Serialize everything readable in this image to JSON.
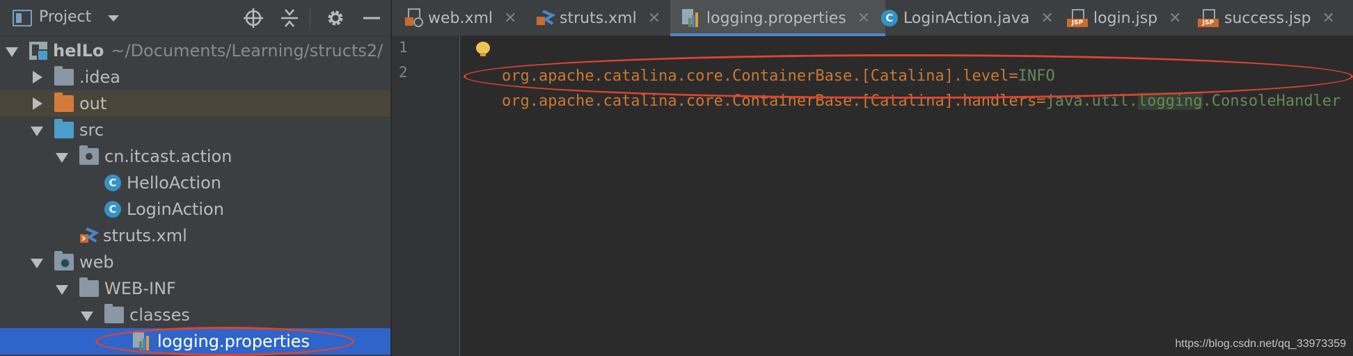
{
  "project_panel": {
    "title": "Project",
    "tree": [
      {
        "label": "helLo",
        "hint": "~/Documents/Learning/structs2/",
        "expanded": true,
        "icon": "module-icon"
      },
      {
        "label": ".idea",
        "expanded": false,
        "icon": "folder-icon"
      },
      {
        "label": "out",
        "expanded": false,
        "icon": "folder-orange-icon"
      },
      {
        "label": "src",
        "expanded": true,
        "icon": "source-folder-icon"
      },
      {
        "label": "cn.itcast.action",
        "expanded": true,
        "icon": "package-icon"
      },
      {
        "label": "HelloAction",
        "icon": "java-class-icon",
        "icon_letter": "C"
      },
      {
        "label": "LoginAction",
        "icon": "java-class-icon",
        "icon_letter": "C"
      },
      {
        "label": "struts.xml",
        "icon": "struts-xml-icon"
      },
      {
        "label": "web",
        "expanded": true,
        "icon": "web-folder-icon"
      },
      {
        "label": "WEB-INF",
        "expanded": true,
        "icon": "folder-icon"
      },
      {
        "label": "classes",
        "expanded": true,
        "icon": "folder-icon"
      },
      {
        "label": "logging.properties",
        "icon": "properties-file-icon",
        "selected": true
      }
    ]
  },
  "tabs": [
    {
      "label": "web.xml",
      "icon": "web-xml-icon"
    },
    {
      "label": "struts.xml",
      "icon": "struts-xml-icon"
    },
    {
      "label": "logging.properties",
      "icon": "properties-file-icon",
      "active": true
    },
    {
      "label": "LoginAction.java",
      "icon": "java-class-icon",
      "icon_letter": "C"
    },
    {
      "label": "login.jsp",
      "icon": "jsp-file-icon",
      "icon_text": "JSP"
    },
    {
      "label": "success.jsp",
      "icon": "jsp-file-icon",
      "icon_text": "JSP"
    }
  ],
  "tab_close_glyph": "✕",
  "editor": {
    "line_numbers": [
      "1",
      "2"
    ],
    "lines": [
      {
        "key": "org.apache.catalina.core.ContainerBase.[Catalina].level",
        "eq": "=",
        "value_pre": "INFO",
        "value_hl": "",
        "value_post": ""
      },
      {
        "key": "org.apache.catalina.core.ContainerBase.[Catalina].handlers",
        "eq": "=",
        "value_pre": "java.util.",
        "value_hl": "logging",
        "value_post": ".ConsoleHandler"
      }
    ]
  },
  "watermark": "https://blog.csdn.net/qq_33973359",
  "colors": {
    "key": "#cc7832",
    "value": "#6a8759",
    "selection": "#2f65ca",
    "annotation_ellipse": "#e0432f"
  }
}
